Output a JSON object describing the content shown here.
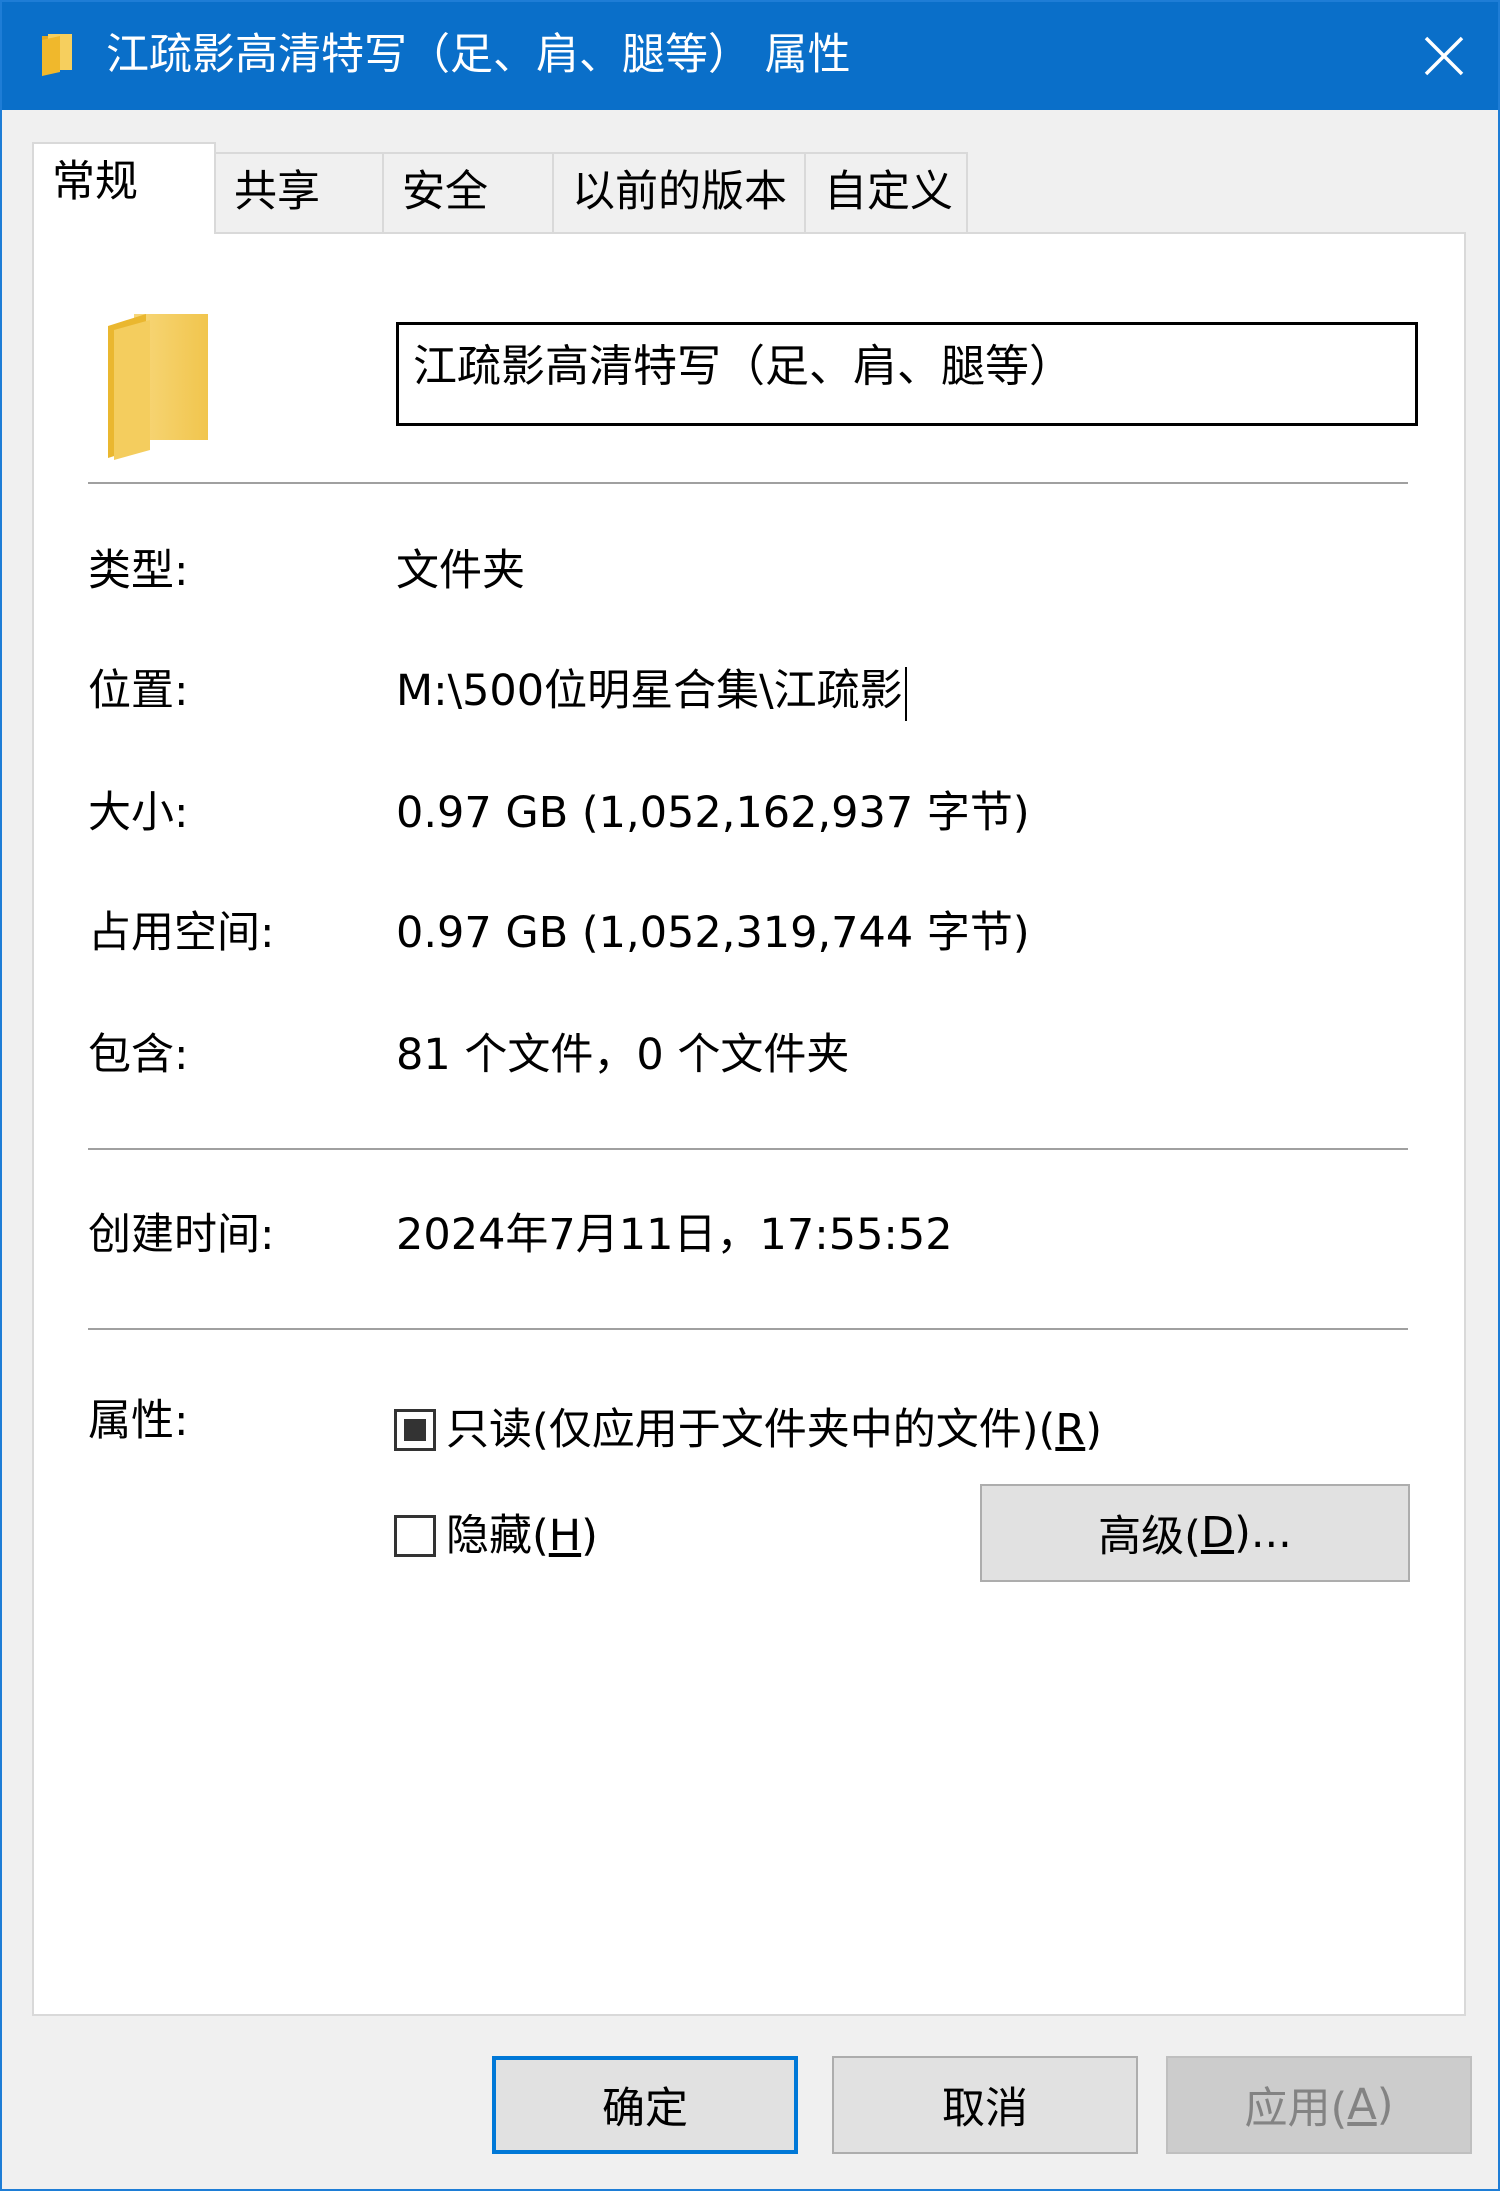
{
  "window": {
    "title": "江疏影高清特写（足、肩、腿等） 属性",
    "folder_icon": "folder-icon",
    "close_icon": "close-icon"
  },
  "tabs": [
    {
      "label": "常规",
      "active": true
    },
    {
      "label": "共享"
    },
    {
      "label": "安全"
    },
    {
      "label": "以前的版本"
    },
    {
      "label": "自定义"
    }
  ],
  "general": {
    "name_value": "江疏影高清特写（足、肩、腿等）",
    "rows": {
      "type": {
        "label": "类型:",
        "value": "文件夹"
      },
      "location": {
        "label": "位置:",
        "value": "M:\\500位明星合集\\江疏影"
      },
      "size": {
        "label": "大小:",
        "value": "0.97 GB (1,052,162,937 字节)"
      },
      "size_on_disk": {
        "label": "占用空间:",
        "value": "0.97 GB (1,052,319,744 字节)"
      },
      "contains": {
        "label": "包含:",
        "value": "81 个文件，0 个文件夹"
      },
      "created": {
        "label": "创建时间:",
        "value": "2024年7月11日，17:55:52"
      }
    },
    "attributes": {
      "label": "属性:",
      "readonly": {
        "text": "只读(仅应用于文件夹中的文件)(",
        "key": "R",
        "close": ")",
        "state": "indeterminate"
      },
      "hidden": {
        "text": "隐藏(",
        "key": "H",
        "close": ")",
        "state": "unchecked"
      },
      "advanced": {
        "text": "高级(",
        "key": "D",
        "close": ")..."
      }
    }
  },
  "footer": {
    "ok": "确定",
    "cancel": "取消",
    "apply": {
      "text": "应用(",
      "key": "A",
      "close": ")"
    }
  },
  "colors": {
    "titlebar": "#0a6fc9",
    "folder": "#f2ca5b",
    "default_button_border": "#0078d7"
  }
}
